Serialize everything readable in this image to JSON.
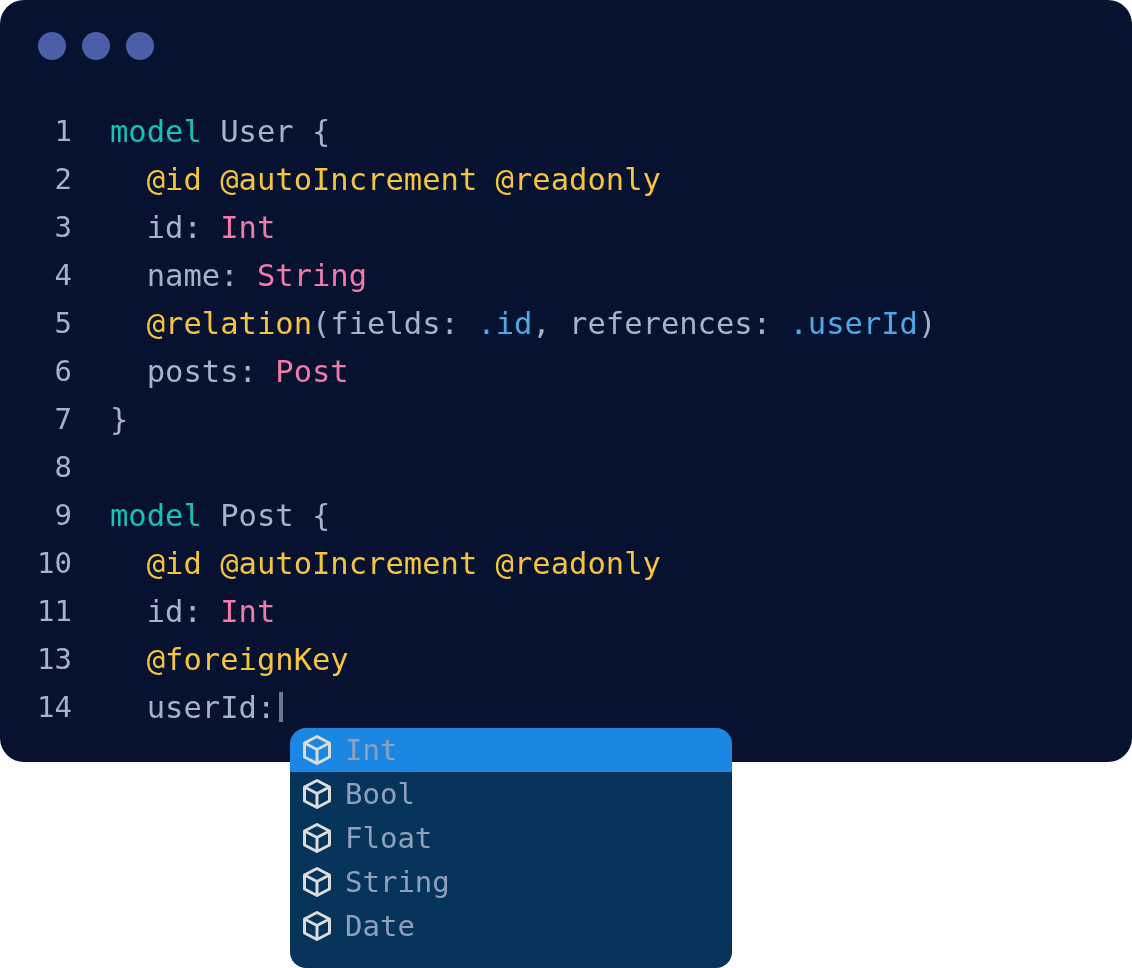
{
  "editor": {
    "lines": [
      {
        "number": "1",
        "cursor": false,
        "tokens": [
          {
            "kind": "keyword",
            "text": "model"
          },
          {
            "kind": "plain",
            "text": " User {"
          }
        ]
      },
      {
        "number": "2",
        "cursor": false,
        "tokens": [
          {
            "kind": "decorator",
            "text": "  @id @autoIncrement @readonly"
          }
        ]
      },
      {
        "number": "3",
        "cursor": false,
        "tokens": [
          {
            "kind": "plain",
            "text": "  id: "
          },
          {
            "kind": "type",
            "text": "Int"
          }
        ]
      },
      {
        "number": "4",
        "cursor": false,
        "tokens": [
          {
            "kind": "plain",
            "text": "  name: "
          },
          {
            "kind": "type",
            "text": "String"
          }
        ]
      },
      {
        "number": "5",
        "cursor": false,
        "tokens": [
          {
            "kind": "decorator",
            "text": "  @relation"
          },
          {
            "kind": "plain",
            "text": "(fields: "
          },
          {
            "kind": "member",
            "text": ".id"
          },
          {
            "kind": "plain",
            "text": ", references: "
          },
          {
            "kind": "member",
            "text": ".userId"
          },
          {
            "kind": "plain",
            "text": ")"
          }
        ]
      },
      {
        "number": "6",
        "cursor": false,
        "tokens": [
          {
            "kind": "plain",
            "text": "  posts: "
          },
          {
            "kind": "type",
            "text": "Post"
          }
        ]
      },
      {
        "number": "7",
        "cursor": false,
        "tokens": [
          {
            "kind": "plain",
            "text": "}"
          }
        ]
      },
      {
        "number": "8",
        "cursor": false
      },
      {
        "number": "9",
        "cursor": false,
        "tokens": [
          {
            "kind": "keyword",
            "text": "model"
          },
          {
            "kind": "plain",
            "text": " Post {"
          }
        ]
      },
      {
        "number": "10",
        "cursor": false,
        "tokens": [
          {
            "kind": "decorator",
            "text": "  @id @autoIncrement @readonly"
          }
        ]
      },
      {
        "number": "11",
        "cursor": false,
        "tokens": [
          {
            "kind": "plain",
            "text": "  id: "
          },
          {
            "kind": "type",
            "text": "Int"
          }
        ]
      },
      {
        "number": "13",
        "cursor": false,
        "tokens": [
          {
            "kind": "decorator",
            "text": "  @foreignKey"
          }
        ]
      },
      {
        "number": "14",
        "cursor": true,
        "tokens": [
          {
            "kind": "plain",
            "text": "  userId:"
          }
        ]
      }
    ]
  },
  "completion": {
    "items": [
      {
        "label": "Int",
        "selected": true
      },
      {
        "label": "Bool",
        "selected": false
      },
      {
        "label": "Float",
        "selected": false
      },
      {
        "label": "String",
        "selected": false
      },
      {
        "label": "Date",
        "selected": false
      }
    ]
  }
}
